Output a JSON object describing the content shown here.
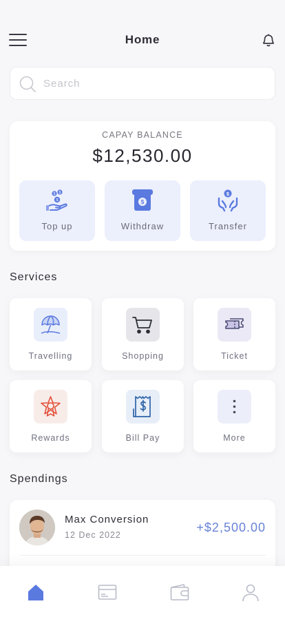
{
  "header": {
    "title": "Home"
  },
  "search": {
    "placeholder": "Search",
    "value": ""
  },
  "balance": {
    "label": "CAPAY BALANCE",
    "amount": "$12,530.00",
    "actions": [
      {
        "label": "Top up",
        "icon": "coins-hand-icon"
      },
      {
        "label": "Withdraw",
        "icon": "atm-withdraw-icon"
      },
      {
        "label": "Transfer",
        "icon": "transfer-hands-icon"
      }
    ]
  },
  "services": {
    "title": "Services",
    "items": [
      {
        "label": "Travelling",
        "icon": "umbrella-beach-icon"
      },
      {
        "label": "Shopping",
        "icon": "shopping-cart-icon"
      },
      {
        "label": "Ticket",
        "icon": "ticket-icon"
      },
      {
        "label": "Rewards",
        "icon": "star-badge-icon"
      },
      {
        "label": "Bill Pay",
        "icon": "receipt-dollar-icon"
      },
      {
        "label": "More",
        "icon": "more-vertical-icon"
      }
    ]
  },
  "spendings": {
    "title": "Spendings",
    "transactions": [
      {
        "name": "Max Conversion",
        "date": "12 Dec 2022",
        "amount": "+$2,500.00"
      }
    ]
  },
  "nav": {
    "items": [
      {
        "icon": "home-icon",
        "active": true
      },
      {
        "icon": "card-icon",
        "active": false
      },
      {
        "icon": "wallet-icon",
        "active": false
      },
      {
        "icon": "profile-icon",
        "active": false
      }
    ]
  },
  "colors": {
    "accent": "#5b7ae0",
    "amount": "#6882d8",
    "action_bg": "#eceffc",
    "rewards": "#e2503a"
  }
}
